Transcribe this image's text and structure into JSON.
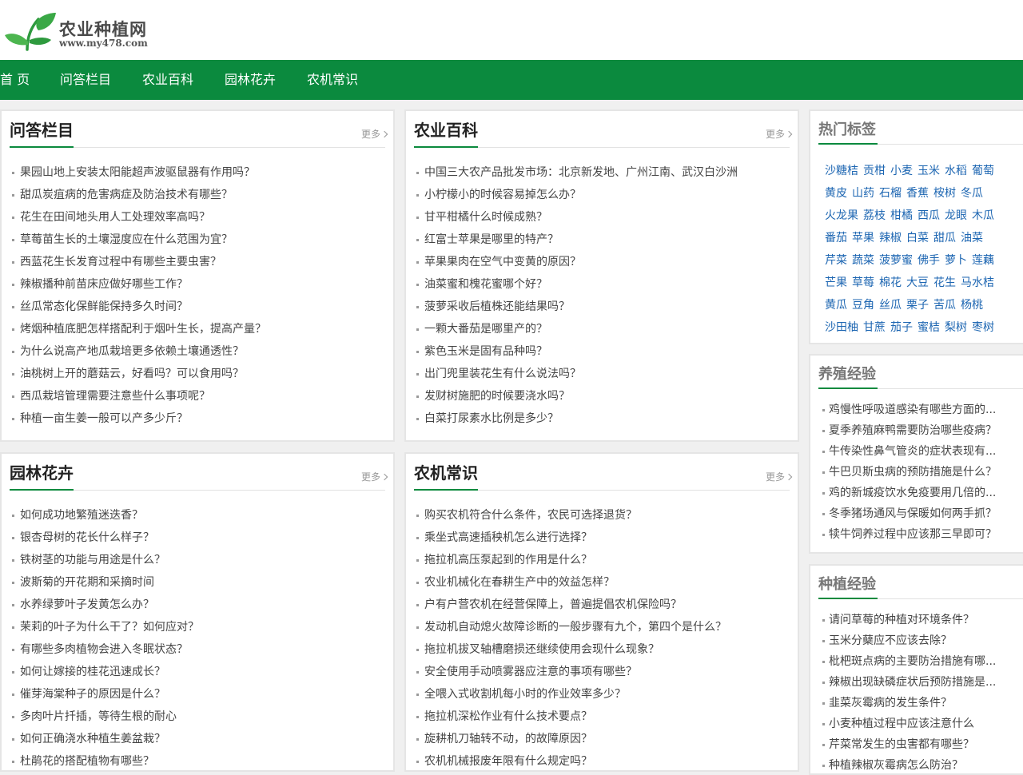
{
  "site": {
    "name": "农业种植网",
    "url": "www.my478.com"
  },
  "nav": [
    "首 页",
    "问答栏目",
    "农业百科",
    "园林花卉",
    "农机常识"
  ],
  "more_label": "更多",
  "sections": [
    {
      "title": "问答栏目",
      "items": [
        "果园山地上安装太阳能超声波驱鼠器有作用吗？",
        "甜瓜炭疽病的危害病症及防治技术有哪些？",
        "花生在田间地头用人工处理效率高吗？",
        "草莓苗生长的土壤湿度应在什么范围为宜？",
        "西蓝花生长发育过程中有哪些主要虫害？",
        "辣椒播种前苗床应做好哪些工作？",
        "丝瓜常态化保鲜能保持多久时间？",
        "烤烟种植底肥怎样搭配利于烟叶生长，提高产量？",
        "为什么说高产地瓜栽培更多依赖土壤通透性？",
        "油桃树上开的蘑菇云，好看吗？可以食用吗？",
        "西瓜栽培管理需要注意些什么事项呢？",
        "种植一亩生姜一般可以产多少斤？"
      ]
    },
    {
      "title": "农业百科",
      "items": [
        "中国三大农产品批发市场：北京新发地、广州江南、武汉白沙洲",
        "小柠檬小的时候容易掉怎么办？",
        "甘平柑橘什么时候成熟？",
        "红富士苹果是哪里的特产？",
        "苹果果肉在空气中变黄的原因？",
        "油菜蜜和槐花蜜哪个好？",
        "菠萝采收后植株还能结果吗？",
        "一颗大番茄是哪里产的？",
        "紫色玉米是固有品种吗？",
        "出门兜里装花生有什么说法吗？",
        "发财树施肥的时候要浇水吗？",
        "白菜打尿素水比例是多少？"
      ]
    },
    {
      "title": "园林花卉",
      "items": [
        "如何成功地繁殖迷迭香？",
        "银杏母树的花长什么样子？",
        "铁树茎的功能与用途是什么？",
        "波斯菊的开花期和采摘时间",
        "水养绿萝叶子发黄怎么办？",
        "茉莉的叶子为什么干了？如何应对？",
        "有哪些多肉植物会进入冬眠状态？",
        "如何让嫁接的桂花迅速成长？",
        "催芽海棠种子的原因是什么？",
        "多肉叶片扦插，等待生根的耐心",
        "如何正确浇水种植生姜盆栽？",
        "杜鹃花的搭配植物有哪些？"
      ]
    },
    {
      "title": "农机常识",
      "items": [
        "购买农机符合什么条件，农民可选择退货？",
        "乘坐式高速插秧机怎么进行选择？",
        "拖拉机高压泵起到的作用是什么？",
        "农业机械化在春耕生产中的效益怎样？",
        "户有户营农机在经营保障上，普遍提倡农机保险吗？",
        "发动机自动熄火故障诊断的一般步骤有九个，第四个是什么？",
        "拖拉机拔叉轴槽磨损还继续使用会现什么现象？",
        "安全使用手动喷雾器应注意的事项有哪些？",
        "全喂入式收割机每小时的作业效率多少？",
        "拖拉机深松作业有什么技术要点？",
        "旋耕机刀轴转不动，的故障原因？",
        "农机机械报废年限有什么规定吗？"
      ]
    }
  ],
  "hot_tags": {
    "title": "热门标签",
    "rows": [
      [
        "沙糖桔",
        "贡柑",
        "小麦",
        "玉米",
        "水稻",
        "葡萄"
      ],
      [
        "黄皮",
        "山药",
        "石榴",
        "香蕉",
        "桉树",
        "冬瓜"
      ],
      [
        "火龙果",
        "荔枝",
        "柑橘",
        "西瓜",
        "龙眼",
        "木瓜"
      ],
      [
        "番茄",
        "苹果",
        "辣椒",
        "白菜",
        "甜瓜",
        "油菜"
      ],
      [
        "芹菜",
        "蔬菜",
        "菠萝蜜",
        "佛手",
        "萝卜",
        "莲藕"
      ],
      [
        "芒果",
        "草莓",
        "棉花",
        "大豆",
        "花生",
        "马水桔"
      ],
      [
        "黄瓜",
        "豆角",
        "丝瓜",
        "栗子",
        "苦瓜",
        "杨桃"
      ],
      [
        "沙田柚",
        "甘蔗",
        "茄子",
        "蜜桔",
        "梨树",
        "枣树"
      ]
    ]
  },
  "breeding": {
    "title": "养殖经验",
    "items": [
      "鸡慢性呼吸道感染有哪些方面的...",
      "夏季养殖麻鸭需要防治哪些疫病？",
      "牛传染性鼻气管炎的症状表现有...",
      "牛巴贝斯虫病的预防措施是什么？",
      "鸡的新城疫饮水免疫要用几倍的...",
      "冬季猪场通风与保暖如何两手抓？",
      "犊牛饲养过程中应该那三早即可？"
    ]
  },
  "planting": {
    "title": "种植经验",
    "items": [
      "请问草莓的种植对环境条件？",
      "玉米分蘖应不应该去除？",
      "枇杷斑点病的主要防治措施有哪...",
      "辣椒出现缺磷症状后预防措施是...",
      "韭菜灰霉病的发生条件？",
      "小麦种植过程中应该注意什么",
      "芹菜常发生的虫害都有哪些？",
      "种植辣椒灰霉病怎么防治？"
    ]
  }
}
